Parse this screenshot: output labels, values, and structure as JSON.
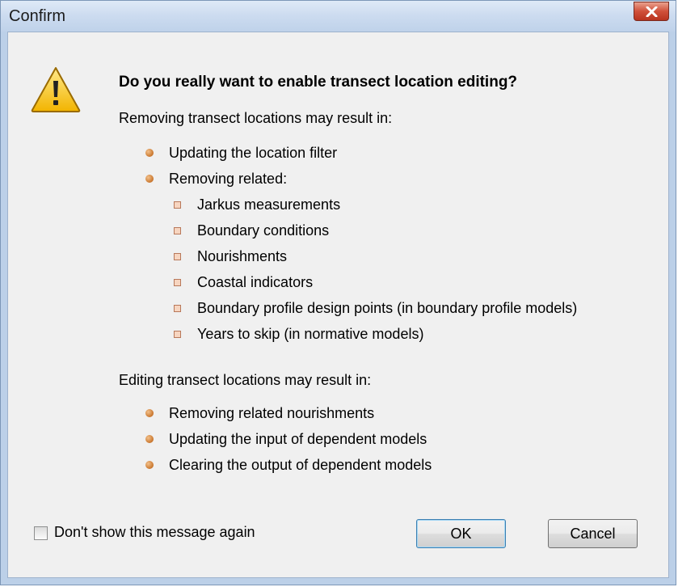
{
  "window": {
    "title": "Confirm",
    "close_icon": "close-icon"
  },
  "dialog": {
    "icon": "warning-icon",
    "heading": "Do you really want to enable transect location editing?",
    "removing_intro": "Removing transect locations may result in:",
    "removing_items": [
      "Updating the location filter",
      "Removing related:"
    ],
    "removing_related": [
      "Jarkus measurements",
      "Boundary conditions",
      "Nourishments",
      "Coastal indicators",
      "Boundary profile design points (in boundary profile models)",
      "Years to skip (in normative models)"
    ],
    "editing_intro": "Editing transect locations may result in:",
    "editing_items": [
      "Removing related nourishments",
      "Updating the input of dependent models",
      "Clearing the output of dependent models"
    ],
    "checkbox_label": "Don't show this message again",
    "checkbox_checked": false,
    "ok_label": "OK",
    "cancel_label": "Cancel"
  },
  "colors": {
    "close_button": "#c8452f",
    "bullet": "#c9762d",
    "default_button_border": "#3c7fb1"
  }
}
